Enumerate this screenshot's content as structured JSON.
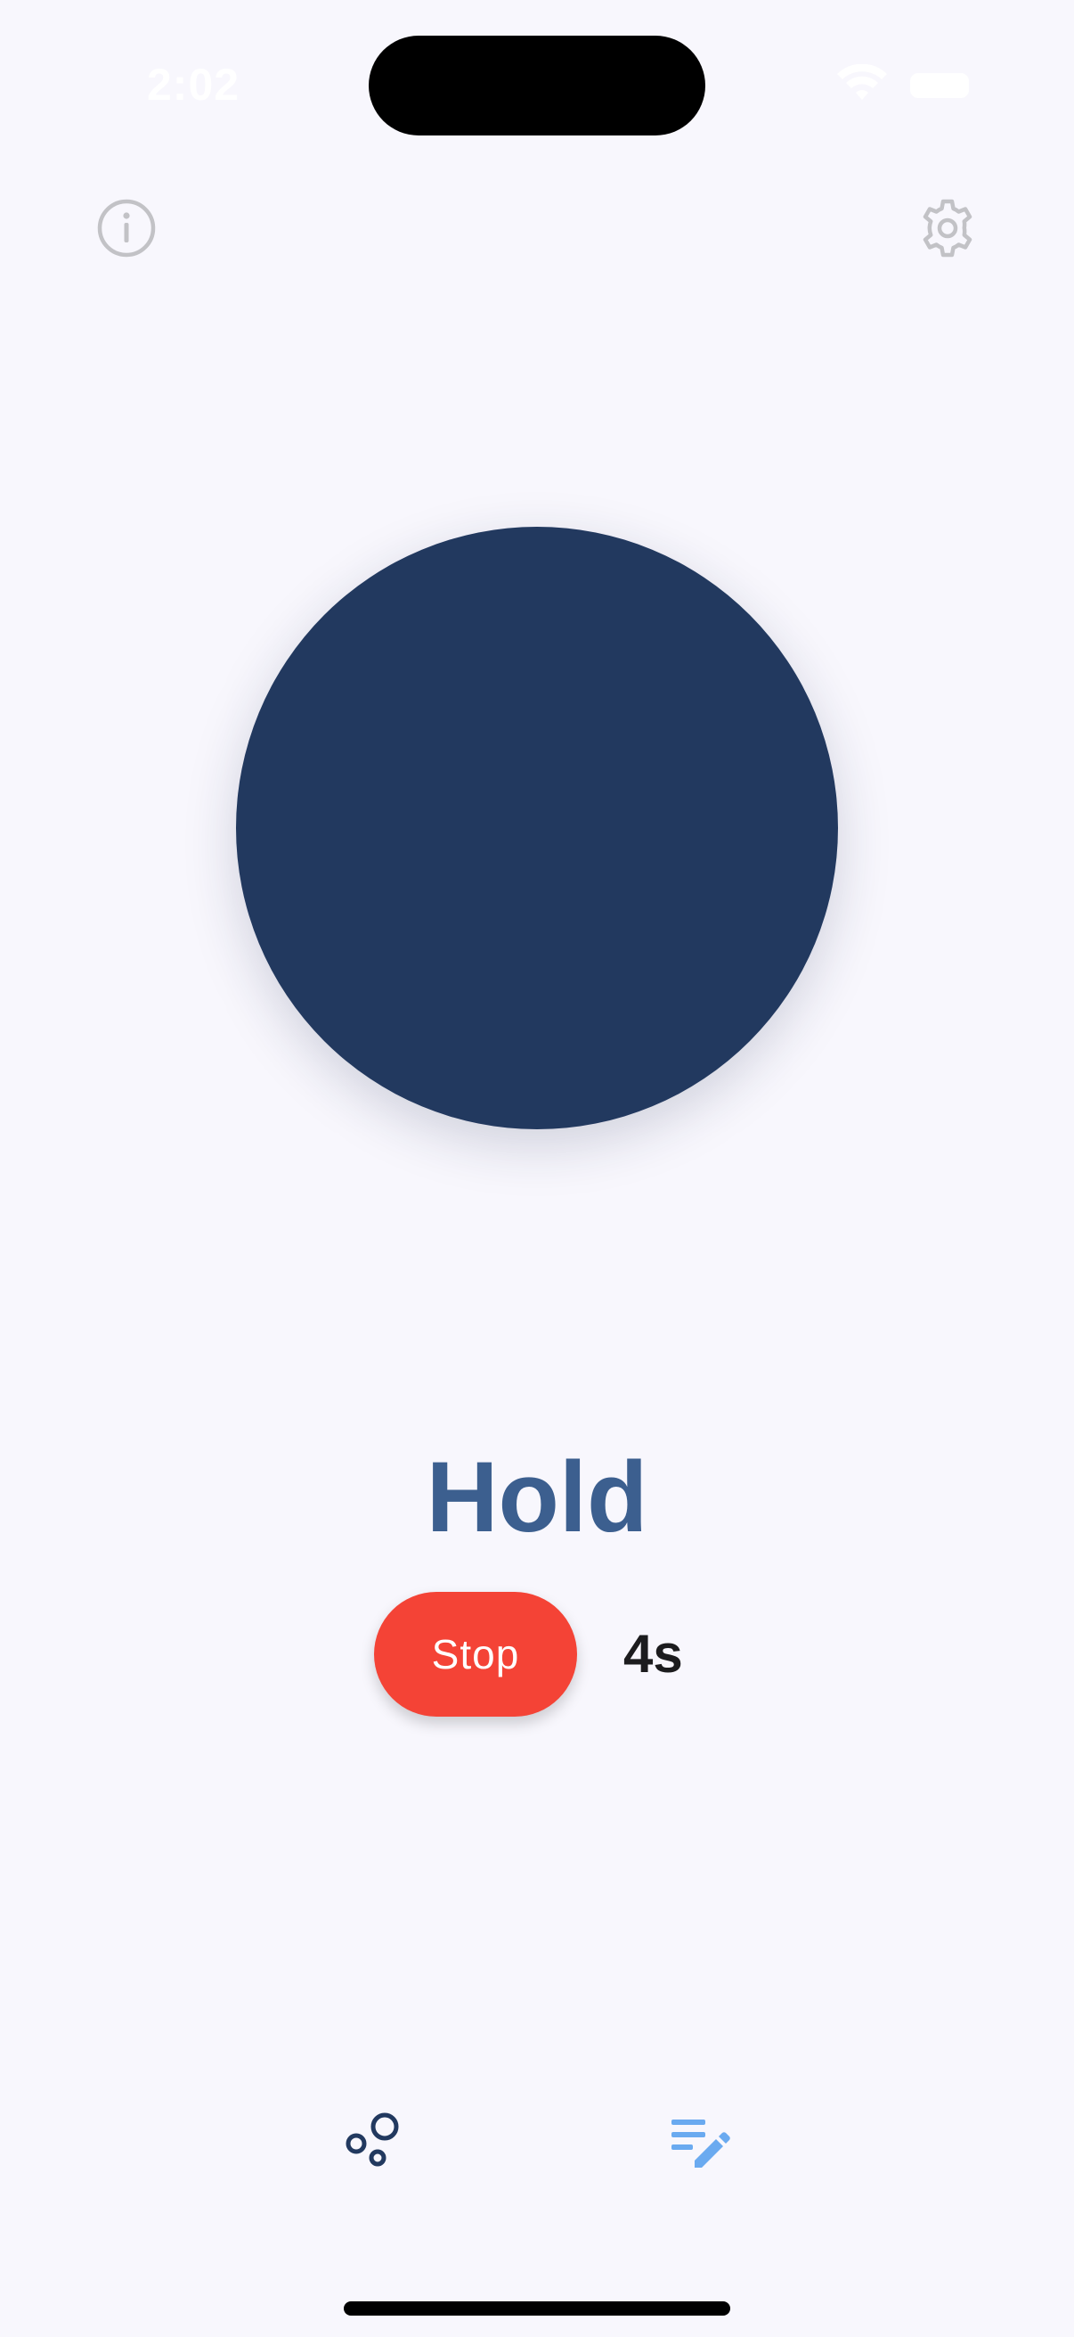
{
  "status_bar": {
    "time": "2:02",
    "wifi_icon": "wifi-icon",
    "battery_icon": "battery-icon"
  },
  "header": {
    "info_icon": "info-icon",
    "settings_icon": "gear-icon"
  },
  "breathing": {
    "phase": "Hold",
    "stop_label": "Stop",
    "timer": "4s"
  },
  "bottom_nav": {
    "items": [
      {
        "icon": "bubbles-icon",
        "active": false
      },
      {
        "icon": "notes-edit-icon",
        "active": true
      }
    ]
  },
  "colors": {
    "background": "#f8f7fd",
    "circle": "#22395f",
    "phase_text": "#3c5f8f",
    "stop_button": "#f44336",
    "nav_active": "#6aaaf0",
    "nav_inactive": "#22395f"
  }
}
